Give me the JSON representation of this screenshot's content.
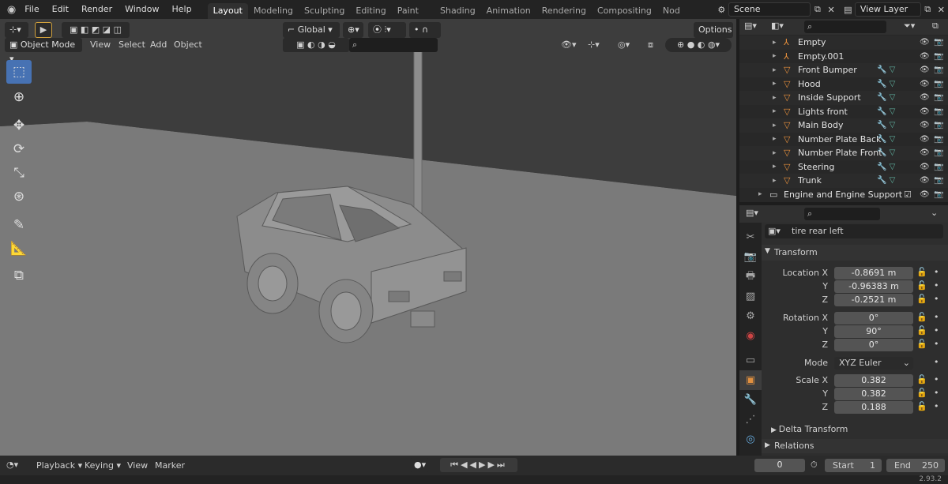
{
  "topbar": {
    "menus": [
      "File",
      "Edit",
      "Render",
      "Window",
      "Help"
    ],
    "workspace_tabs": [
      "Layout",
      "Modeling",
      "Sculpting",
      "UV Editing",
      "Texture Paint",
      "Shading",
      "Animation",
      "Rendering",
      "Compositing",
      "Geometry Nod"
    ],
    "active_tab": "Layout",
    "scene": "Scene",
    "view_layer": "View Layer"
  },
  "viewport": {
    "mode": "Object Mode",
    "menus": [
      "View",
      "Select",
      "Add",
      "Object"
    ],
    "transform_orientation": "Global",
    "options_label": "Options"
  },
  "outliner": {
    "rows": [
      {
        "name": "Empty",
        "kind": "empty"
      },
      {
        "name": "Empty.001",
        "kind": "empty"
      },
      {
        "name": "Front Bumper",
        "kind": "mesh"
      },
      {
        "name": "Hood",
        "kind": "mesh"
      },
      {
        "name": "Inside Support",
        "kind": "mesh"
      },
      {
        "name": "Lights front",
        "kind": "mesh"
      },
      {
        "name": "Main Body",
        "kind": "mesh"
      },
      {
        "name": "Number Plate Back",
        "kind": "mesh"
      },
      {
        "name": "Number Plate Front",
        "kind": "mesh"
      },
      {
        "name": "Steering",
        "kind": "mesh"
      },
      {
        "name": "Trunk",
        "kind": "mesh"
      },
      {
        "name": "Engine and Engine Support",
        "kind": "collection"
      }
    ]
  },
  "properties": {
    "object_name": "tire rear left",
    "transform_title": "Transform",
    "location_label": "Location X",
    "location": [
      "-0.8691 m",
      "-0.96383 m",
      "-0.2521 m"
    ],
    "rotation_label": "Rotation X",
    "rotation": [
      "0°",
      "90°",
      "0°"
    ],
    "mode_label": "Mode",
    "mode_value": "XYZ Euler",
    "scale_label": "Scale X",
    "scale": [
      "0.382",
      "0.382",
      "0.188"
    ],
    "axis_y": "Y",
    "axis_z": "Z",
    "delta_transform": "Delta Transform",
    "relations": "Relations"
  },
  "timeline": {
    "menus": [
      "Playback",
      "Keying",
      "View",
      "Marker"
    ],
    "current_frame": "0",
    "start_label": "Start",
    "start_value": "1",
    "end_label": "End",
    "end_value": "250"
  },
  "status": {
    "version": "2.93.2"
  }
}
